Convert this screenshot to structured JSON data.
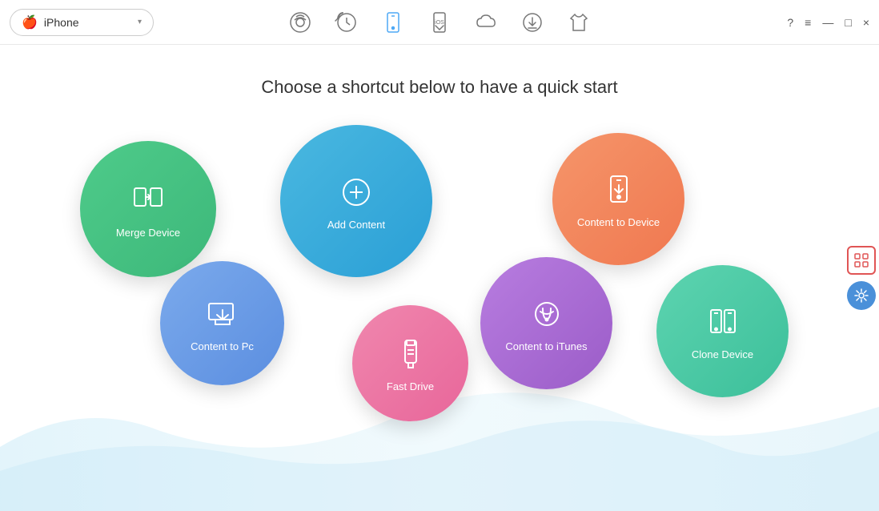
{
  "titleBar": {
    "deviceName": "iPhone",
    "dropdownArrow": "▾",
    "appleSymbol": ""
  },
  "toolbar": {
    "icons": [
      {
        "id": "music-transfer",
        "label": "Music Transfer",
        "active": false
      },
      {
        "id": "backup",
        "label": "Backup",
        "active": false
      },
      {
        "id": "device",
        "label": "Device",
        "active": true
      },
      {
        "id": "ios-update",
        "label": "iOS Update",
        "active": false
      },
      {
        "id": "cloud",
        "label": "Cloud",
        "active": false
      },
      {
        "id": "download",
        "label": "Download",
        "active": false
      },
      {
        "id": "theme",
        "label": "Theme",
        "active": false
      }
    ]
  },
  "windowControls": {
    "help": "?",
    "menu": "≡",
    "minimize": "—",
    "restore": "□",
    "close": "×"
  },
  "mainContent": {
    "title": "Choose a shortcut below to have a quick start",
    "circles": [
      {
        "id": "merge-device",
        "label": "Merge Device"
      },
      {
        "id": "add-content",
        "label": "Add Content"
      },
      {
        "id": "content-to-device",
        "label": "Content to Device"
      },
      {
        "id": "content-to-pc",
        "label": "Content to Pc"
      },
      {
        "id": "fast-drive",
        "label": "Fast Drive"
      },
      {
        "id": "content-to-itunes",
        "label": "Content to iTunes"
      },
      {
        "id": "clone-device",
        "label": "Clone Device"
      }
    ]
  },
  "sidebar": {
    "gridLabel": "Grid",
    "toolsLabel": "Tools"
  }
}
